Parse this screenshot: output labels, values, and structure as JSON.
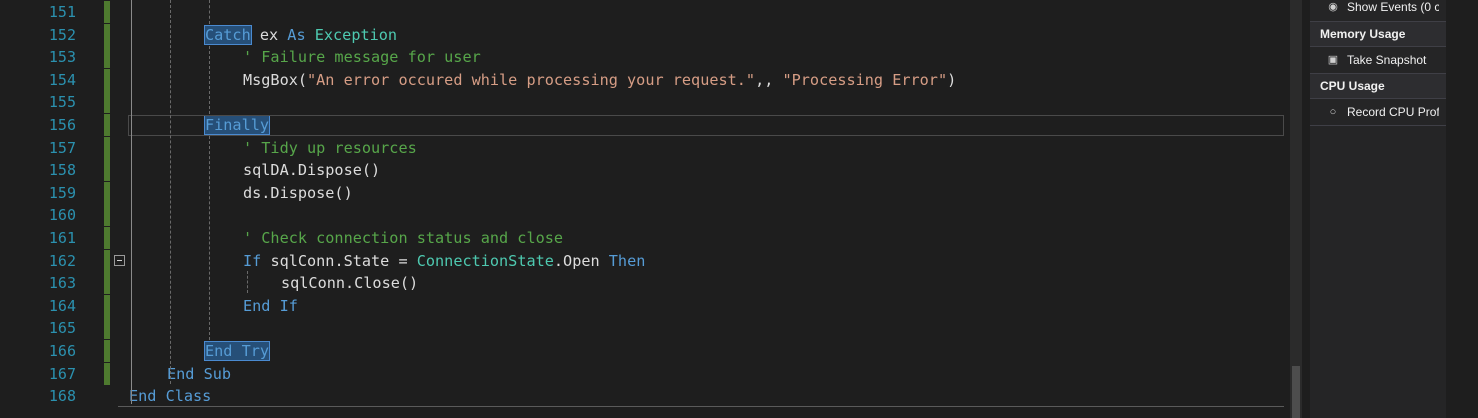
{
  "editor": {
    "lines": [
      {
        "num": "151",
        "indent": 0,
        "tokens": []
      },
      {
        "num": "152",
        "indent": 2,
        "tokens": [
          {
            "t": "Catch",
            "c": "kw",
            "hl": true
          },
          {
            "t": " ex ",
            "c": "pl"
          },
          {
            "t": "As",
            "c": "kw"
          },
          {
            "t": " ",
            "c": "pl"
          },
          {
            "t": "Exception",
            "c": "ty"
          }
        ]
      },
      {
        "num": "153",
        "indent": 3,
        "tokens": [
          {
            "t": "' Failure message for user",
            "c": "cm"
          }
        ]
      },
      {
        "num": "154",
        "indent": 3,
        "tokens": [
          {
            "t": "MsgBox(",
            "c": "pl"
          },
          {
            "t": "\"An error occured while processing your request.\"",
            "c": "st"
          },
          {
            "t": ",, ",
            "c": "pl"
          },
          {
            "t": "\"Processing Error\"",
            "c": "st"
          },
          {
            "t": ")",
            "c": "pl"
          }
        ]
      },
      {
        "num": "155",
        "indent": 0,
        "tokens": []
      },
      {
        "num": "156",
        "indent": 2,
        "tokens": [
          {
            "t": "Finally",
            "c": "kw",
            "hl": true
          }
        ]
      },
      {
        "num": "157",
        "indent": 3,
        "tokens": [
          {
            "t": "' Tidy up resources",
            "c": "cm"
          }
        ]
      },
      {
        "num": "158",
        "indent": 3,
        "tokens": [
          {
            "t": "sqlDA.Dispose()",
            "c": "pl"
          }
        ]
      },
      {
        "num": "159",
        "indent": 3,
        "tokens": [
          {
            "t": "ds.Dispose()",
            "c": "pl"
          }
        ]
      },
      {
        "num": "160",
        "indent": 0,
        "tokens": []
      },
      {
        "num": "161",
        "indent": 3,
        "tokens": [
          {
            "t": "' Check connection status and close",
            "c": "cm"
          }
        ]
      },
      {
        "num": "162",
        "indent": 3,
        "tokens": [
          {
            "t": "If",
            "c": "kw"
          },
          {
            "t": " sqlConn.State = ",
            "c": "pl"
          },
          {
            "t": "ConnectionState",
            "c": "ty"
          },
          {
            "t": ".Open ",
            "c": "pl"
          },
          {
            "t": "Then",
            "c": "kw"
          }
        ]
      },
      {
        "num": "163",
        "indent": 4,
        "tokens": [
          {
            "t": "sqlConn.Close()",
            "c": "pl"
          }
        ]
      },
      {
        "num": "164",
        "indent": 3,
        "tokens": [
          {
            "t": "End If",
            "c": "kw"
          }
        ]
      },
      {
        "num": "165",
        "indent": 0,
        "tokens": []
      },
      {
        "num": "166",
        "indent": 2,
        "tokens": [
          {
            "t": "End Try",
            "c": "kw",
            "hl": true
          }
        ]
      },
      {
        "num": "167",
        "indent": 1,
        "tokens": [
          {
            "t": "End Sub",
            "c": "kw"
          }
        ]
      },
      {
        "num": "168",
        "indent": 0,
        "tokens": [
          {
            "t": "End Class",
            "c": "kw"
          }
        ]
      }
    ]
  },
  "diagnostics": {
    "events_label": "Show Events (0 c",
    "events_icon": "events-icon",
    "memory_header": "Memory Usage",
    "snapshot_label": "Take Snapshot",
    "snapshot_icon": "camera-icon",
    "cpu_header": "CPU Usage",
    "cpu_label": "Record CPU Prof",
    "cpu_icon": "record-icon"
  }
}
